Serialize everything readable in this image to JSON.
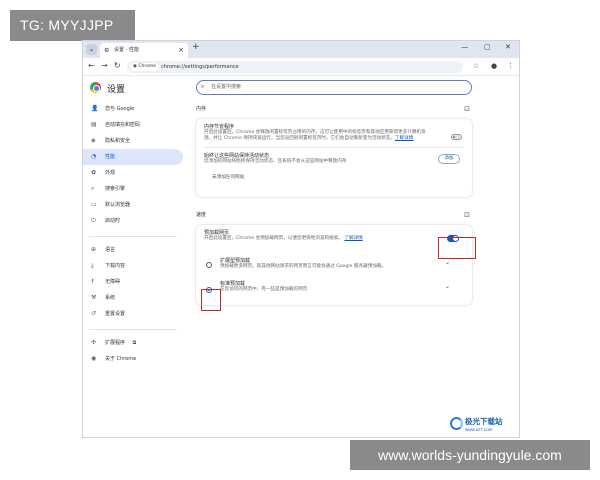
{
  "overlay": {
    "tag": "TG: MYYJJPP",
    "site": "www.worlds-yundingyule.com"
  },
  "browser": {
    "tab_title": "设置 - 性能",
    "tab_menu_icon": "chevron-down-icon",
    "url_chip": "Chrome",
    "url": "chrome://settings/performance"
  },
  "settings": {
    "title": "设置",
    "search_placeholder": "在设置中搜索"
  },
  "sidebar": {
    "items": [
      {
        "label": "您与 Google",
        "icon": "person-icon"
      },
      {
        "label": "自动填充和密码",
        "icon": "clipboard-icon"
      },
      {
        "label": "隐私和安全",
        "icon": "shield-icon"
      },
      {
        "label": "性能",
        "icon": "speedometer-icon",
        "active": true
      },
      {
        "label": "外观",
        "icon": "palette-icon"
      },
      {
        "label": "搜索引擎",
        "icon": "search-icon"
      },
      {
        "label": "默认浏览器",
        "icon": "browser-icon"
      },
      {
        "label": "启动时",
        "icon": "power-icon"
      }
    ],
    "items2": [
      {
        "label": "语言",
        "icon": "globe-icon"
      },
      {
        "label": "下载内容",
        "icon": "download-icon"
      },
      {
        "label": "无障碍",
        "icon": "accessibility-icon"
      },
      {
        "label": "系统",
        "icon": "wrench-icon"
      },
      {
        "label": "重置设置",
        "icon": "history-icon"
      }
    ],
    "items3": [
      {
        "label": "扩展程序",
        "icon": "puzzle-icon"
      },
      {
        "label": "关于 Chrome",
        "icon": "chrome-icon"
      }
    ]
  },
  "memory": {
    "heading": "内存",
    "saver_title": "内存节省程序",
    "saver_desc": "开启此设置后，Chrome 会释放闲置标签页占用的内存。这可让使用中的标签页和其他应用获得更多计算机资源，并让 Chrome 保持快速运行。当您返回到闲置标签页时，它们会自动重新变为活动状态。",
    "saver_link": "了解详情",
    "always_active_title": "始终让这些网站保持活动状态",
    "always_active_desc": "您添加的网站将始终保持活动状态，且系统不会从这些网站中释放内存",
    "add_button": "添加",
    "no_sites": "未添加任何网站"
  },
  "speed": {
    "heading": "速度",
    "preload_title": "预加载网页",
    "preload_desc": "开启此设置后，Chrome 会预加载网页，以便您更快地浏览和搜索。",
    "preload_link": "了解详情",
    "extended_title": "扩展型预加载",
    "extended_desc": "预加载更多网页。就其他网站请求的网页而言可能会通过 Google 服务器预加载。",
    "standard_title": "标准预加载",
    "standard_desc": "在您访问的网页中，有一些是预加载的网页"
  },
  "watermark": {
    "title": "极光下载站",
    "url": "www.xz7.com"
  },
  "colors": {
    "accent": "#0b57d0",
    "highlight": "#c62828",
    "tabstrip": "#dfe6f2"
  }
}
